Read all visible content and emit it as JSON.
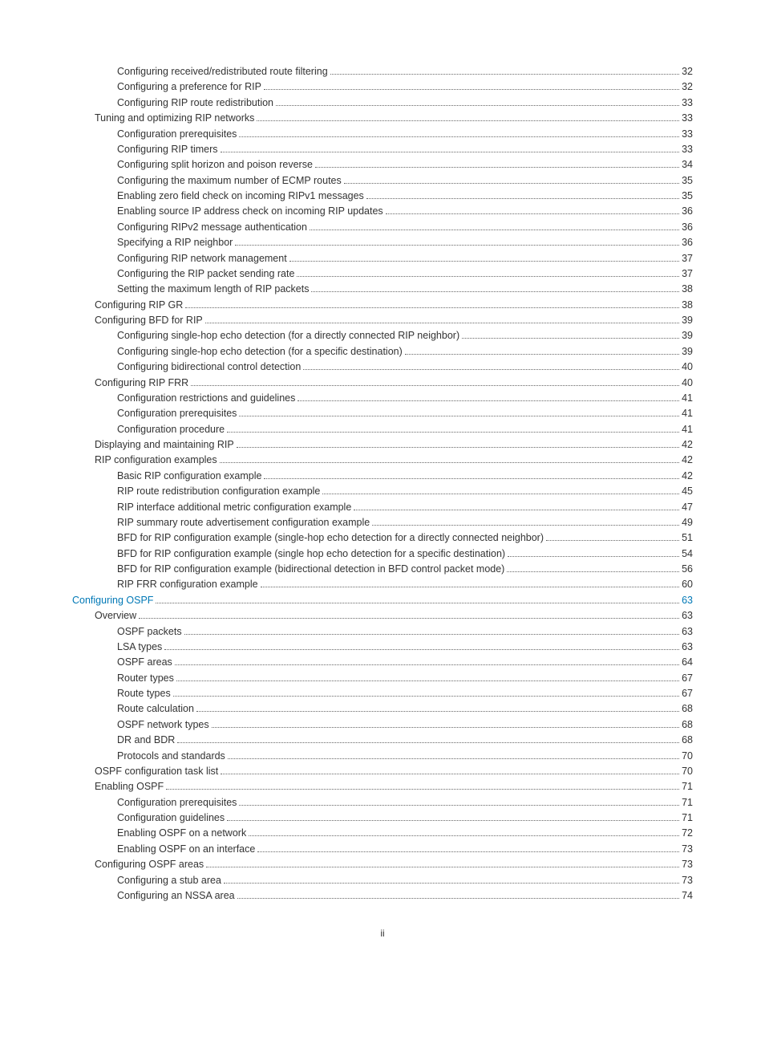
{
  "toc": [
    {
      "label": "Configuring received/redistributed route filtering",
      "page": "32",
      "indent": 2,
      "link": false
    },
    {
      "label": "Configuring a preference for RIP",
      "page": "32",
      "indent": 2,
      "link": false
    },
    {
      "label": "Configuring RIP route redistribution",
      "page": "33",
      "indent": 2,
      "link": false
    },
    {
      "label": "Tuning and optimizing RIP networks",
      "page": "33",
      "indent": 1,
      "link": false
    },
    {
      "label": "Configuration prerequisites",
      "page": "33",
      "indent": 2,
      "link": false
    },
    {
      "label": "Configuring RIP timers",
      "page": "33",
      "indent": 2,
      "link": false
    },
    {
      "label": "Configuring split horizon and poison reverse",
      "page": "34",
      "indent": 2,
      "link": false
    },
    {
      "label": "Configuring the maximum number of ECMP routes",
      "page": "35",
      "indent": 2,
      "link": false
    },
    {
      "label": "Enabling zero field check on incoming RIPv1 messages",
      "page": "35",
      "indent": 2,
      "link": false
    },
    {
      "label": "Enabling source IP address check on incoming RIP updates",
      "page": "36",
      "indent": 2,
      "link": false
    },
    {
      "label": "Configuring RIPv2 message authentication",
      "page": "36",
      "indent": 2,
      "link": false
    },
    {
      "label": "Specifying a RIP neighbor",
      "page": "36",
      "indent": 2,
      "link": false
    },
    {
      "label": "Configuring RIP network management",
      "page": "37",
      "indent": 2,
      "link": false
    },
    {
      "label": "Configuring the RIP packet sending rate",
      "page": "37",
      "indent": 2,
      "link": false
    },
    {
      "label": "Setting the maximum length of RIP packets",
      "page": "38",
      "indent": 2,
      "link": false
    },
    {
      "label": "Configuring RIP GR",
      "page": "38",
      "indent": 1,
      "link": false
    },
    {
      "label": "Configuring BFD for RIP",
      "page": "39",
      "indent": 1,
      "link": false
    },
    {
      "label": "Configuring single-hop echo detection (for a directly connected RIP neighbor)",
      "page": "39",
      "indent": 2,
      "link": false
    },
    {
      "label": "Configuring single-hop echo detection (for a specific destination)",
      "page": "39",
      "indent": 2,
      "link": false
    },
    {
      "label": "Configuring bidirectional control detection",
      "page": "40",
      "indent": 2,
      "link": false
    },
    {
      "label": "Configuring RIP FRR",
      "page": "40",
      "indent": 1,
      "link": false
    },
    {
      "label": "Configuration restrictions and guidelines",
      "page": "41",
      "indent": 2,
      "link": false
    },
    {
      "label": "Configuration prerequisites",
      "page": "41",
      "indent": 2,
      "link": false
    },
    {
      "label": "Configuration procedure",
      "page": "41",
      "indent": 2,
      "link": false
    },
    {
      "label": "Displaying and maintaining RIP",
      "page": "42",
      "indent": 1,
      "link": false
    },
    {
      "label": "RIP configuration examples",
      "page": "42",
      "indent": 1,
      "link": false
    },
    {
      "label": "Basic RIP configuration example",
      "page": "42",
      "indent": 2,
      "link": false
    },
    {
      "label": "RIP route redistribution configuration example",
      "page": "45",
      "indent": 2,
      "link": false
    },
    {
      "label": "RIP interface additional metric configuration example",
      "page": "47",
      "indent": 2,
      "link": false
    },
    {
      "label": "RIP summary route advertisement configuration example",
      "page": "49",
      "indent": 2,
      "link": false
    },
    {
      "label": "BFD for RIP configuration example (single-hop echo detection for a directly connected neighbor)",
      "page": "51",
      "indent": 2,
      "link": false
    },
    {
      "label": "BFD for RIP configuration example (single hop echo detection for a specific destination)",
      "page": "54",
      "indent": 2,
      "link": false
    },
    {
      "label": "BFD for RIP configuration example (bidirectional detection in BFD control packet mode)",
      "page": "56",
      "indent": 2,
      "link": false
    },
    {
      "label": "RIP FRR configuration example",
      "page": "60",
      "indent": 2,
      "link": false
    },
    {
      "label": "Configuring OSPF",
      "page": "63",
      "indent": 0,
      "link": true
    },
    {
      "label": "Overview",
      "page": "63",
      "indent": 1,
      "link": false
    },
    {
      "label": "OSPF packets",
      "page": "63",
      "indent": 2,
      "link": false
    },
    {
      "label": "LSA types",
      "page": "63",
      "indent": 2,
      "link": false
    },
    {
      "label": "OSPF areas",
      "page": "64",
      "indent": 2,
      "link": false
    },
    {
      "label": "Router types",
      "page": "67",
      "indent": 2,
      "link": false
    },
    {
      "label": "Route types",
      "page": "67",
      "indent": 2,
      "link": false
    },
    {
      "label": "Route calculation",
      "page": "68",
      "indent": 2,
      "link": false
    },
    {
      "label": "OSPF network types",
      "page": "68",
      "indent": 2,
      "link": false
    },
    {
      "label": "DR and BDR",
      "page": "68",
      "indent": 2,
      "link": false
    },
    {
      "label": "Protocols and standards",
      "page": "70",
      "indent": 2,
      "link": false
    },
    {
      "label": "OSPF configuration task list",
      "page": "70",
      "indent": 1,
      "link": false
    },
    {
      "label": "Enabling OSPF",
      "page": "71",
      "indent": 1,
      "link": false
    },
    {
      "label": "Configuration prerequisites",
      "page": "71",
      "indent": 2,
      "link": false
    },
    {
      "label": "Configuration guidelines",
      "page": "71",
      "indent": 2,
      "link": false
    },
    {
      "label": "Enabling OSPF on a network",
      "page": "72",
      "indent": 2,
      "link": false
    },
    {
      "label": "Enabling OSPF on an interface",
      "page": "73",
      "indent": 2,
      "link": false
    },
    {
      "label": "Configuring OSPF areas",
      "page": "73",
      "indent": 1,
      "link": false
    },
    {
      "label": "Configuring a stub area",
      "page": "73",
      "indent": 2,
      "link": false
    },
    {
      "label": "Configuring an NSSA area",
      "page": "74",
      "indent": 2,
      "link": false
    }
  ],
  "footer": "ii"
}
